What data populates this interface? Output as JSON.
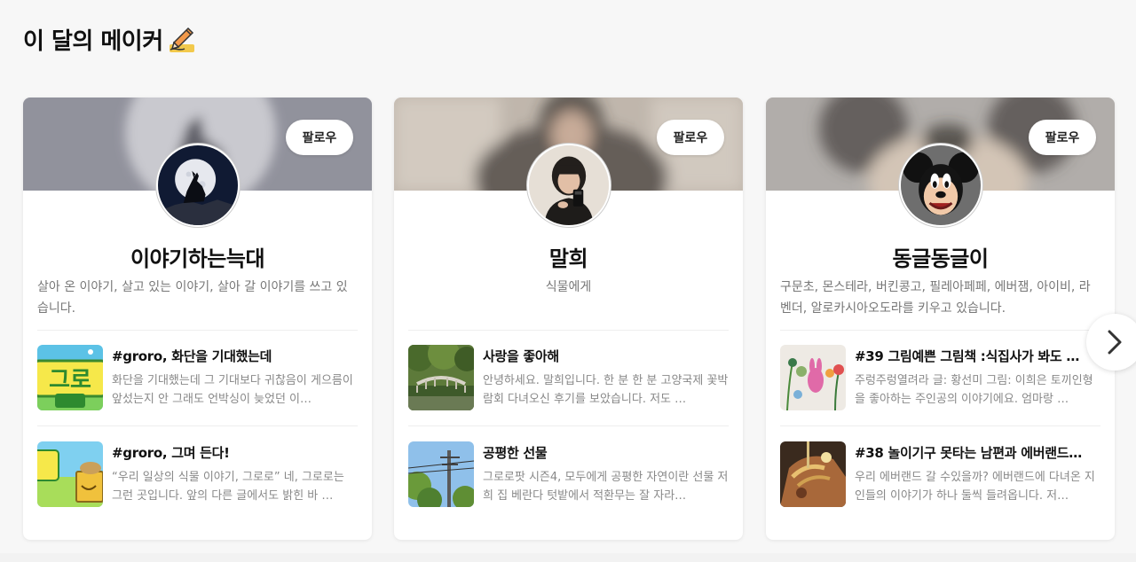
{
  "section": {
    "title": "이 달의 메이커",
    "title_icon": "pencil-writing-icon"
  },
  "makers": [
    {
      "name": "이야기하는늑대",
      "description": "살아 온 이야기, 살고 있는 이야기, 살아 갈 이야기를 쓰고 있습니다.",
      "follow_label": "팔로우",
      "avatar_icon": "howling-wolf-moon-avatar",
      "posts": [
        {
          "title": "#groro, 화단을 기대했는데",
          "body": "화단을 기대했는데 그 기대보다 귀찮음이 게으름이 앞섰는지 안 그래도 언박싱이 늦었던 이…"
        },
        {
          "title": "#groro, 그며 든다!",
          "body": "“우리 일상의 식물 이야기, 그로로” 네, 그로로는 그런 곳입니다. 앞의 다른 글에서도 밝힌 바 …"
        }
      ]
    },
    {
      "name": "말희",
      "description": "식물에게",
      "follow_label": "팔로우",
      "avatar_icon": "person-selfie-avatar",
      "posts": [
        {
          "title": "사랑을 좋아해",
          "body": "안녕하세요. 말희입니다. 한 분 한 분 고양국제 꽃박람회 다녀오신 후기를 보았습니다. 저도 …"
        },
        {
          "title": "공평한 선물",
          "body": "그로로팟 시즌4, 모두에게 공평한 자연이란 선물 저희 집 베란다 텃밭에서 적환무는 잘 자라…"
        }
      ]
    },
    {
      "name": "동글동글이",
      "description": "구문초, 몬스테라, 버킨콩고, 필레아페페, 에버잼, 아이비, 라벤더, 알로카시아오도라를 키우고 있습니다.",
      "follow_label": "팔로우",
      "avatar_icon": "mickey-mouse-avatar",
      "posts": [
        {
          "title": "#39 그림예쁜 그림책 :식집사가 봐도 …",
          "body": "주렁주렁열려라 글: 황선미 그림: 이희은 토끼인형을 좋아하는 주인공의 이야기에요. 엄마랑 …"
        },
        {
          "title": "#38 놀이기구 못타는 남편과 에버랜드…",
          "body": "우리 에버랜드 갈 수있을까? 에버랜드에 다녀온 지인들의 이야기가 하나 둘씩 들려옵니다. 저…"
        }
      ]
    }
  ],
  "navigation": {
    "next_icon": "chevron-right-icon"
  }
}
